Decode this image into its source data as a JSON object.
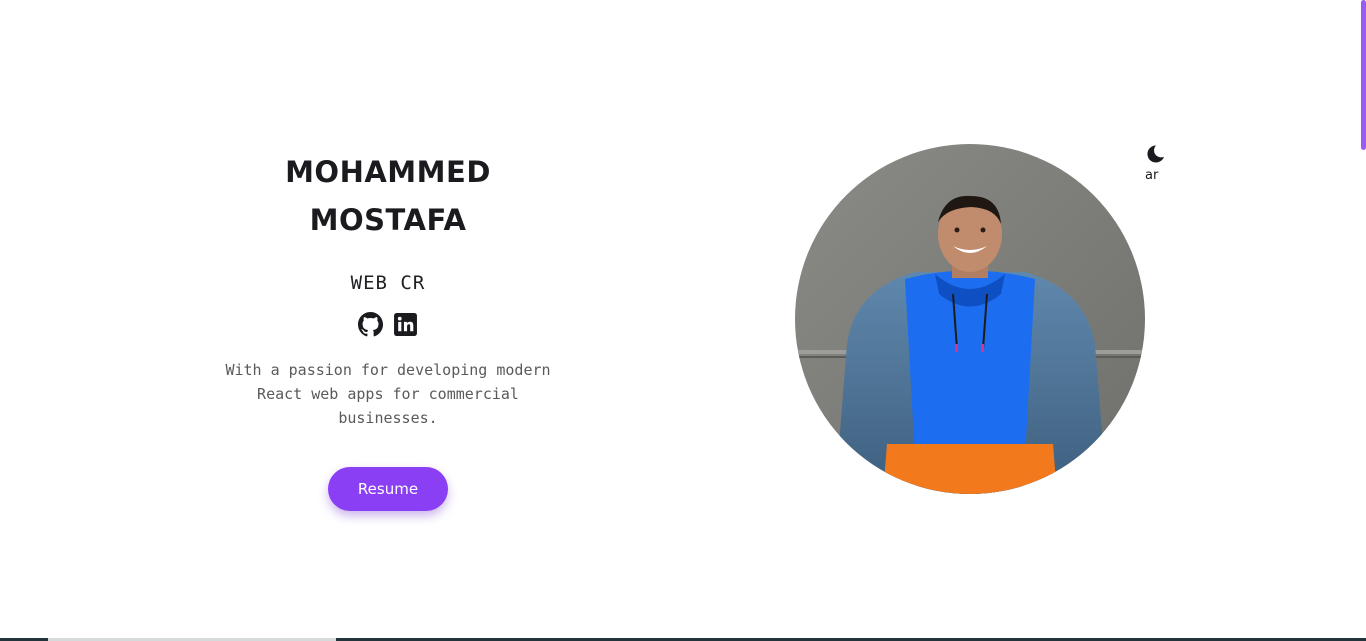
{
  "hero": {
    "name_line_1": "MOHAMMED",
    "name_line_2": "MOSTAFA",
    "role": "WEB CR",
    "tagline": "With a passion for developing modern React web apps for commercial businesses.",
    "resume_label": "Resume",
    "socials": [
      {
        "icon": "github-icon"
      },
      {
        "icon": "linkedin-icon"
      }
    ]
  },
  "controls": {
    "theme_icon": "moon-icon",
    "language_label": "ar"
  },
  "colors": {
    "accent": "#8b3ff5",
    "text": "#1b1b1f",
    "muted": "#5a5a5a",
    "scrollbar": "#9b59f6"
  }
}
